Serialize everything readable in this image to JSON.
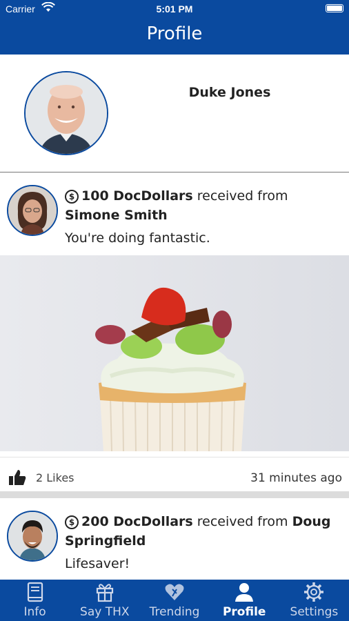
{
  "status_bar": {
    "carrier": "Carrier",
    "time": "5:01 PM"
  },
  "header": {
    "title": "Profile"
  },
  "profile": {
    "name": "Duke Jones"
  },
  "feed": [
    {
      "amount_text": "100 DocDollars",
      "received_from": "received from",
      "sender": "Simone Smith",
      "message": "You're doing fantastic.",
      "likes": "2 Likes",
      "time_ago": "31 minutes ago"
    },
    {
      "amount_text": "200 DocDollars",
      "received_from": "received from",
      "sender": "Doug Springfield",
      "message": "Lifesaver!"
    }
  ],
  "tabs": [
    {
      "label": "Info",
      "icon": "book-icon",
      "active": false
    },
    {
      "label": "Say THX",
      "icon": "gift-icon",
      "active": false
    },
    {
      "label": "Trending",
      "icon": "heart-icon",
      "active": false
    },
    {
      "label": "Profile",
      "icon": "person-icon",
      "active": true
    },
    {
      "label": "Settings",
      "icon": "gear-icon",
      "active": false
    }
  ],
  "colors": {
    "brand": "#0a4a9f",
    "tab_inactive": "#cfd8ea",
    "separator": "#dcdcdc"
  }
}
